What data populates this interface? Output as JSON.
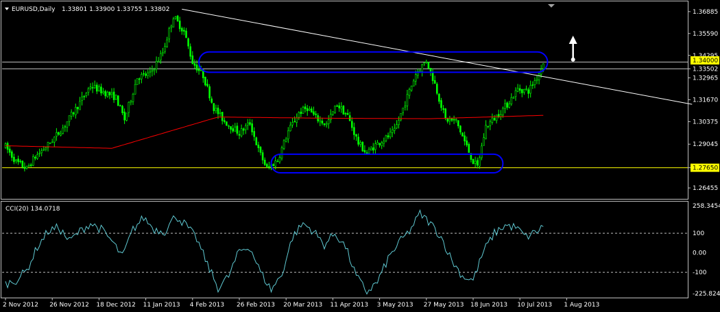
{
  "window": {
    "symbol_info": "EURUSD,Daily",
    "ohlc": "1.33801 1.33900 1.33755 1.33802",
    "indicator_info": "CCI(20) 134.0718"
  },
  "colors": {
    "background": "#000000",
    "frame": "#c0c0c0",
    "candle": "#00ff00",
    "moving_average": "#ff0000",
    "trendline": "#ffffff",
    "channel": "#0000ff",
    "support_line": "#ffff00",
    "resistance_line": "#c0c0c0",
    "price_tag": "#ffff00",
    "cci_line": "#5fc9d2",
    "cci_levels": "#c0c0c0",
    "arrow": "#ffffff"
  },
  "chart_data": [
    {
      "type": "candlestick",
      "price_axis_ticks": [
        "1.36885",
        "1.35590",
        "1.34295",
        "1.33502",
        "1.32965",
        "1.31670",
        "1.30375",
        "1.29045",
        "1.27650",
        "1.26455"
      ],
      "price_tags": [
        "1.34000",
        "1.27650"
      ],
      "date_labels": [
        "2 Nov 2012",
        "26 Nov 2012",
        "18 Dec 2012",
        "11 Jan 2013",
        "4 Feb 2013",
        "26 Feb 2013",
        "20 Mar 2013",
        "11 Apr 2013",
        "3 May 2013",
        "27 May 2013",
        "18 Jun 2013",
        "10 Jul 2013",
        "1 Aug 2013"
      ],
      "ylim": [
        1.2585,
        1.3745
      ],
      "close_anchors": [
        [
          0,
          1.289
        ],
        [
          5,
          1.28
        ],
        [
          10,
          1.276
        ],
        [
          14,
          1.283
        ],
        [
          20,
          1.29
        ],
        [
          27,
          1.3
        ],
        [
          35,
          1.315
        ],
        [
          40,
          1.325
        ],
        [
          45,
          1.322
        ],
        [
          52,
          1.318
        ],
        [
          56,
          1.305
        ],
        [
          62,
          1.33
        ],
        [
          68,
          1.332
        ],
        [
          74,
          1.345
        ],
        [
          79,
          1.366
        ],
        [
          84,
          1.357
        ],
        [
          88,
          1.339
        ],
        [
          93,
          1.331
        ],
        [
          98,
          1.312
        ],
        [
          103,
          1.304
        ],
        [
          110,
          1.297
        ],
        [
          115,
          1.303
        ],
        [
          119,
          1.287
        ],
        [
          123,
          1.276
        ],
        [
          128,
          1.281
        ],
        [
          133,
          1.298
        ],
        [
          138,
          1.309
        ],
        [
          142,
          1.312
        ],
        [
          146,
          1.306
        ],
        [
          151,
          1.302
        ],
        [
          156,
          1.314
        ],
        [
          161,
          1.307
        ],
        [
          166,
          1.291
        ],
        [
          170,
          1.285
        ],
        [
          174,
          1.29
        ],
        [
          179,
          1.294
        ],
        [
          183,
          1.298
        ],
        [
          188,
          1.315
        ],
        [
          193,
          1.332
        ],
        [
          198,
          1.34
        ],
        [
          202,
          1.326
        ],
        [
          207,
          1.305
        ],
        [
          212,
          1.304
        ],
        [
          216,
          1.292
        ],
        [
          220,
          1.28
        ],
        [
          222,
          1.277
        ],
        [
          226,
          1.301
        ],
        [
          231,
          1.307
        ],
        [
          236,
          1.314
        ],
        [
          241,
          1.323
        ],
        [
          246,
          1.322
        ],
        [
          250,
          1.33
        ],
        [
          253,
          1.338
        ]
      ],
      "moving_average": [
        [
          0,
          1.2895
        ],
        [
          50,
          1.288
        ],
        [
          100,
          1.3065
        ],
        [
          150,
          1.3058
        ],
        [
          200,
          1.3055
        ],
        [
          253,
          1.3075
        ]
      ],
      "trendline": [
        [
          83,
          1.3703
        ],
        [
          323,
          1.314
        ]
      ],
      "resistance": [
        1.339,
        1.335
      ],
      "support": 1.2765,
      "channel_upper": {
        "from": 91,
        "to": 255,
        "high": 1.345,
        "low": 1.333
      },
      "channel_lower": {
        "from": 125,
        "to": 234,
        "high": 1.2845,
        "low": 1.2735
      },
      "arrow": {
        "bar": 267,
        "from": 1.3405,
        "to": 1.353
      }
    },
    {
      "type": "line",
      "name": "CCI(20)",
      "axis_ticks": [
        "258.3454",
        "100",
        "0.00",
        "-100",
        "-225.8246"
      ],
      "levels": [
        100,
        -100
      ],
      "ylim": [
        -225.8246,
        258.3454
      ],
      "anchors": [
        [
          0,
          -160
        ],
        [
          5,
          -140
        ],
        [
          10,
          -90
        ],
        [
          15,
          30
        ],
        [
          20,
          110
        ],
        [
          25,
          130
        ],
        [
          30,
          60
        ],
        [
          35,
          110
        ],
        [
          40,
          150
        ],
        [
          45,
          120
        ],
        [
          50,
          60
        ],
        [
          55,
          -20
        ],
        [
          60,
          120
        ],
        [
          65,
          180
        ],
        [
          70,
          120
        ],
        [
          75,
          110
        ],
        [
          80,
          190
        ],
        [
          85,
          140
        ],
        [
          90,
          70
        ],
        [
          95,
          -60
        ],
        [
          100,
          -180
        ],
        [
          105,
          -120
        ],
        [
          110,
          10
        ],
        [
          115,
          30
        ],
        [
          120,
          -100
        ],
        [
          125,
          -190
        ],
        [
          130,
          -110
        ],
        [
          135,
          80
        ],
        [
          140,
          150
        ],
        [
          145,
          110
        ],
        [
          150,
          40
        ],
        [
          155,
          100
        ],
        [
          160,
          30
        ],
        [
          165,
          -120
        ],
        [
          170,
          -200
        ],
        [
          175,
          -150
        ],
        [
          180,
          -30
        ],
        [
          185,
          50
        ],
        [
          190,
          110
        ],
        [
          195,
          200
        ],
        [
          200,
          150
        ],
        [
          205,
          80
        ],
        [
          210,
          -40
        ],
        [
          215,
          -120
        ],
        [
          220,
          -140
        ],
        [
          225,
          10
        ],
        [
          230,
          100
        ],
        [
          235,
          140
        ],
        [
          240,
          130
        ],
        [
          245,
          80
        ],
        [
          250,
          110
        ],
        [
          253,
          134.0718
        ]
      ]
    }
  ]
}
